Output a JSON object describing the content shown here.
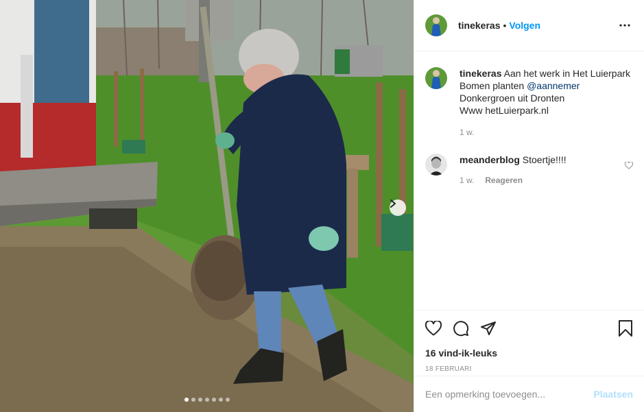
{
  "post": {
    "author": "tinekeras",
    "header_separator": "•",
    "follow_label": "Volgen",
    "caption": {
      "username": "tinekeras",
      "line1": "Aan het werk in Het Luierpark",
      "line2_prefix": "Bomen planten",
      "line2_mention": "@aannemer",
      "line3": "Donkergroen uit Dronten",
      "line4": "Www hetLuierpark.nl",
      "time": "1 w."
    },
    "comments": [
      {
        "username": "meanderblog",
        "text": "Stoertje!!!!",
        "time": "1 w.",
        "reply_label": "Reageren"
      }
    ],
    "likes": "16 vind-ik-leuks",
    "date": "18 FEBRUARI",
    "carousel": {
      "total": 7,
      "active_index": 0
    }
  },
  "add_comment": {
    "placeholder": "Een opmerking toevoegen...",
    "post_label": "Plaatsen"
  },
  "icons": {
    "more": "more-icon",
    "heart": "heart-icon",
    "comment": "comment-icon",
    "share": "share-icon",
    "save": "bookmark-icon",
    "next": "chevron-right-icon"
  },
  "colors": {
    "accent": "#0095f6",
    "mention": "#00376b",
    "muted": "#8e8e8e",
    "post_disabled": "#b2dffc"
  }
}
